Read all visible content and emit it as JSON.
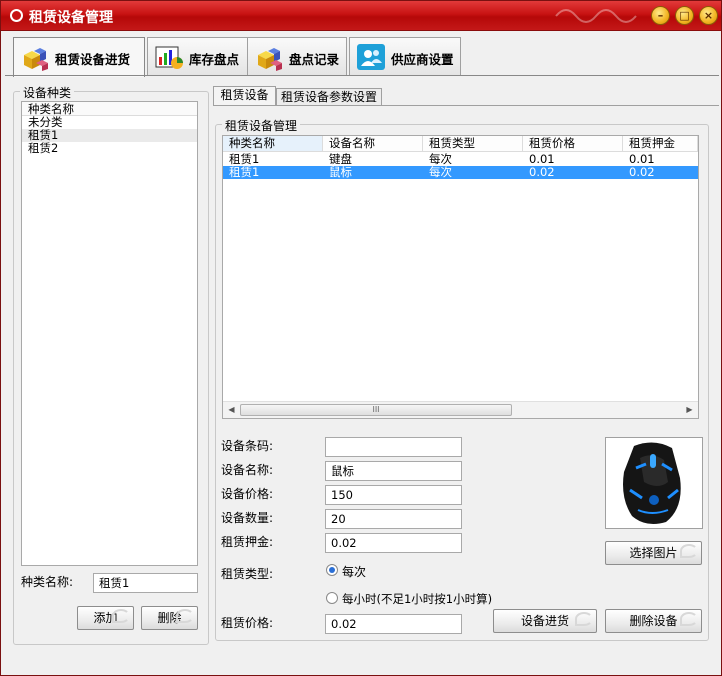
{
  "window": {
    "title": "租赁设备管理",
    "min_glyph": "–",
    "max_glyph": "□",
    "close_glyph": "×"
  },
  "top_tabs": [
    {
      "label": "租赁设备进货",
      "icon": "colored-cubes-icon",
      "active": true
    },
    {
      "label": "库存盘点",
      "icon": "chart-icon",
      "active": false
    },
    {
      "label": "盘点记录",
      "icon": "colored-cubes-icon",
      "active": false
    },
    {
      "label": "供应商设置",
      "icon": "users-icon",
      "active": false
    }
  ],
  "left": {
    "group_title": "设备种类",
    "list_header": "种类名称",
    "items": [
      "未分类",
      "租赁1",
      "租赁2"
    ],
    "selected_index": 1,
    "name_label": "种类名称:",
    "name_value": "租赁1",
    "add_label": "添加",
    "delete_label": "删除"
  },
  "sub_tabs": [
    "租赁设备",
    "租赁设备参数设置"
  ],
  "right": {
    "group_title": "租赁设备管理",
    "columns": [
      "种类名称",
      "设备名称",
      "租赁类型",
      "租赁价格",
      "租赁押金"
    ],
    "rows": [
      [
        "租赁1",
        "键盘",
        "每次",
        "0.01",
        "0.01"
      ],
      [
        "租赁1",
        "鼠标",
        "每次",
        "0.02",
        "0.02"
      ]
    ],
    "selected_row": 1,
    "scroll_thumb_glyph": "III",
    "form": {
      "barcode_label": "设备条码:",
      "barcode_value": "",
      "name_label": "设备名称:",
      "name_value": "鼠标",
      "price_label": "设备价格:",
      "price_value": "150",
      "qty_label": "设备数量:",
      "qty_value": "20",
      "deposit_label": "租赁押金:",
      "deposit_value": "0.02",
      "type_label": "租赁类型:",
      "type_option_1": "每次",
      "type_option_2": "每小时(不足1小时按1小时算)",
      "rent_price_label": "租赁价格:",
      "rent_price_value": "0.02"
    },
    "choose_image_label": "选择图片",
    "stock_in_label": "设备进货",
    "delete_device_label": "删除设备"
  }
}
